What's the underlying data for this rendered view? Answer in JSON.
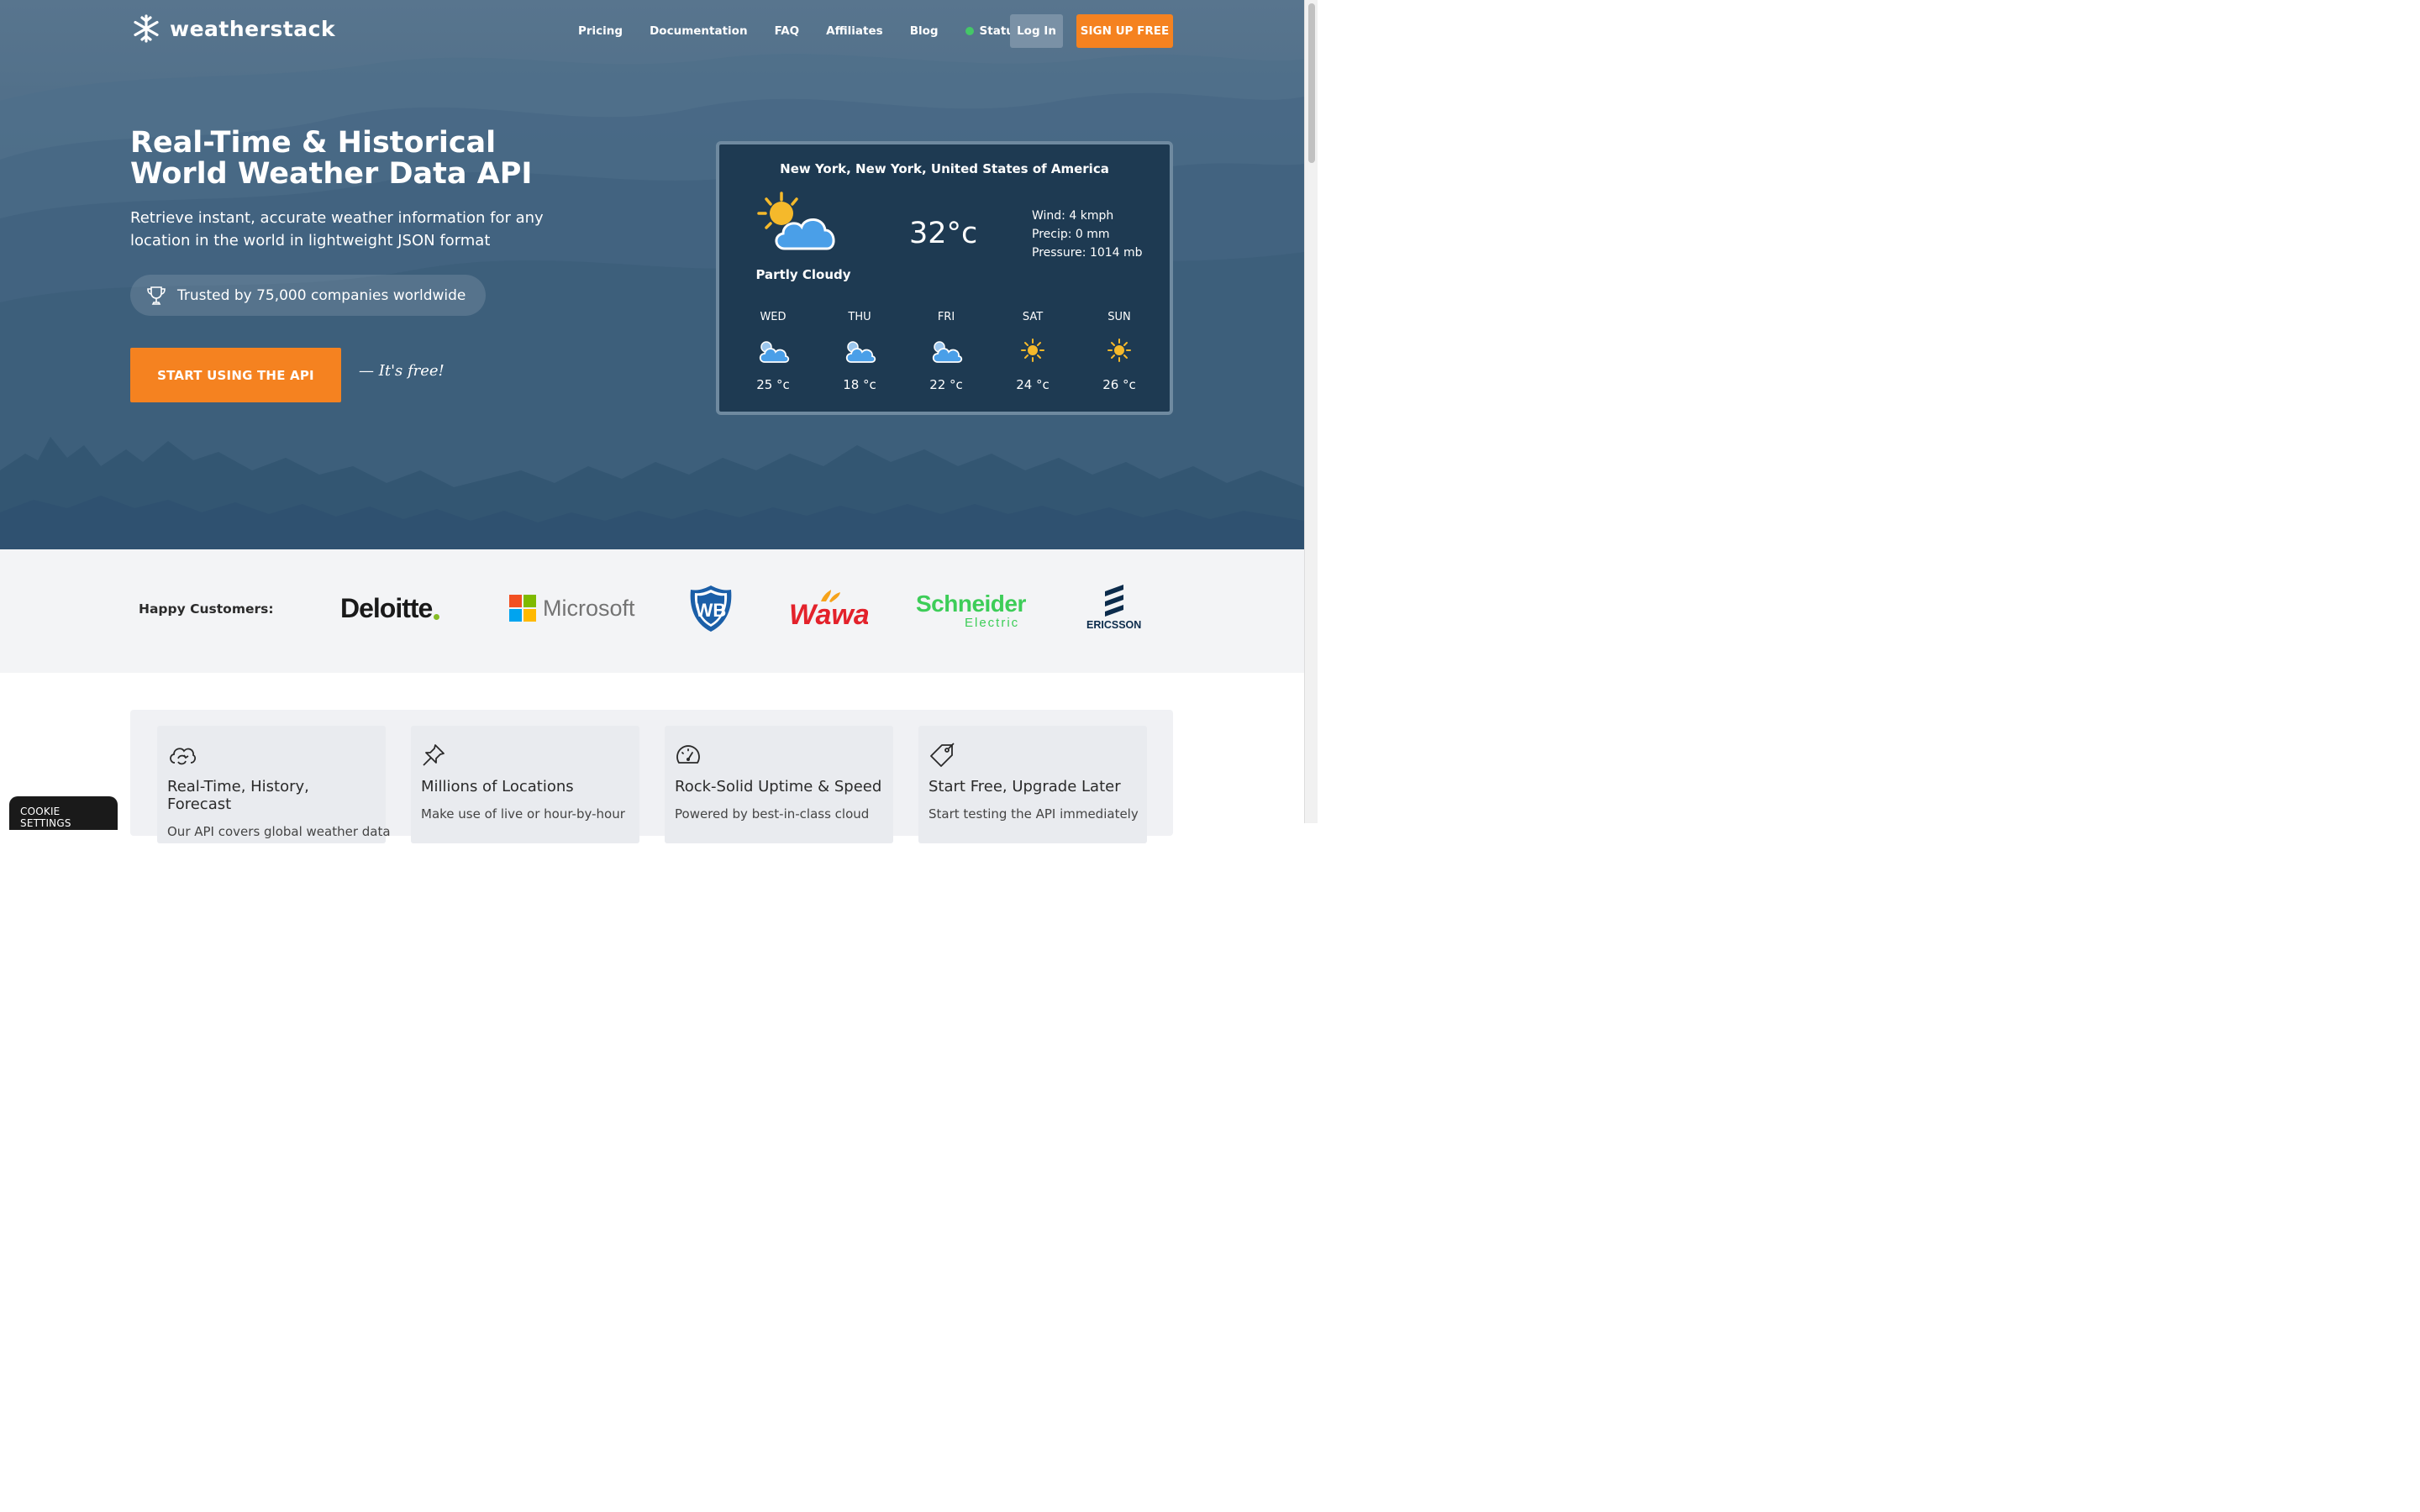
{
  "brand": {
    "name": "weatherstack"
  },
  "nav": {
    "items": [
      "Pricing",
      "Documentation",
      "FAQ",
      "Affiliates",
      "Blog"
    ],
    "status_label": "Status",
    "login_label": "Log In",
    "signup_label": "SIGN UP FREE"
  },
  "hero": {
    "title_line1": "Real-Time & Historical",
    "title_line2": "World Weather Data API",
    "subtitle": "Retrieve instant, accurate weather information for any location in the world in lightweight JSON format",
    "trust": "Trusted by 75,000 companies worldwide",
    "cta_label": "START USING THE API",
    "free_note": "— It's free!"
  },
  "widget": {
    "location": "New York, New York, United States of America",
    "condition": "Partly Cloudy",
    "temperature": "32°c",
    "wind": "Wind: 4 kmph",
    "precip": "Precip: 0 mm",
    "pressure": "Pressure: 1014 mb",
    "forecast": [
      {
        "day": "WED",
        "temp": "25 °c",
        "icon": "cloud-icon"
      },
      {
        "day": "THU",
        "temp": "18 °c",
        "icon": "cloud-icon"
      },
      {
        "day": "FRI",
        "temp": "22 °c",
        "icon": "cloud-icon"
      },
      {
        "day": "SAT",
        "temp": "24 °c",
        "icon": "sun-icon"
      },
      {
        "day": "SUN",
        "temp": "26 °c",
        "icon": "sun-icon"
      }
    ]
  },
  "customers": {
    "label": "Happy Customers:",
    "logos": [
      "Deloitte",
      "Microsoft",
      "WB",
      "Wawa",
      "Schneider",
      "Electric",
      "ERICSSON"
    ]
  },
  "features": [
    {
      "title": "Real-Time, History, Forecast",
      "desc": "Our API covers global weather data",
      "icon": "cloud-sync-icon"
    },
    {
      "title": "Millions of Locations",
      "desc": "Make use of live or hour-by-hour",
      "icon": "pin-icon"
    },
    {
      "title": "Rock-Solid Uptime & Speed",
      "desc": "Powered by best-in-class cloud",
      "icon": "gauge-icon"
    },
    {
      "title": "Start Free, Upgrade Later",
      "desc": "Start testing the API immediately",
      "icon": "tag-icon"
    }
  ],
  "cookie": {
    "label": "COOKIE SETTINGS"
  },
  "colors": {
    "accent": "#f58220",
    "widget_bg": "#1e3a52",
    "hero_bg": "#4a6a85",
    "status_dot": "#44c767"
  }
}
